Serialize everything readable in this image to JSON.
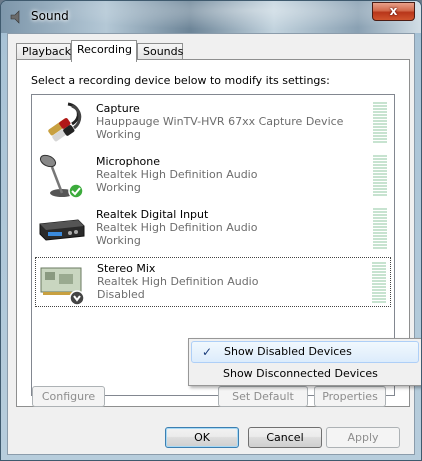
{
  "window": {
    "title": "Sound",
    "close_label": "x"
  },
  "tabs": [
    {
      "label": "Playback",
      "active": false
    },
    {
      "label": "Recording",
      "active": true
    },
    {
      "label": "Sounds",
      "active": false
    }
  ],
  "instruction": "Select a recording device below to modify its settings:",
  "devices": [
    {
      "name": "Capture",
      "description": "Hauppauge WinTV-HVR 67xx Capture Device",
      "status": "Working",
      "icon": "rca-cable-icon"
    },
    {
      "name": "Microphone",
      "description": "Realtek High Definition Audio",
      "status": "Working",
      "icon": "microphone-icon"
    },
    {
      "name": "Realtek Digital Input",
      "description": "Realtek High Definition Audio",
      "status": "Working",
      "icon": "digital-input-icon"
    },
    {
      "name": "Stereo Mix",
      "description": "Realtek High Definition Audio",
      "status": "Disabled",
      "icon": "sound-card-icon"
    }
  ],
  "buttons": {
    "configure": "Configure",
    "set_default": "Set Default",
    "properties": "Properties",
    "ok": "OK",
    "cancel": "Cancel",
    "apply": "Apply"
  },
  "context_menu": [
    {
      "label": "Show Disabled Devices",
      "checked": true
    },
    {
      "label": "Show Disconnected Devices",
      "checked": false
    }
  ],
  "colors": {
    "accent": "#3c7fb1",
    "meter": "#c7e3d0",
    "close_button": "#c8462a"
  }
}
